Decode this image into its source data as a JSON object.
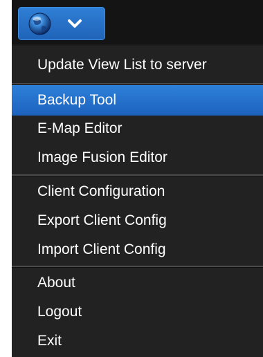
{
  "menu_button": {
    "icon": "globe-icon",
    "dropdown_icon": "chevron-down-icon",
    "accent_color": "#2a73cc"
  },
  "menu": {
    "highlighted_item": "Backup Tool",
    "groups": [
      {
        "items": [
          "Update View List to server"
        ]
      },
      {
        "items": [
          "Backup Tool",
          "E-Map Editor",
          "Image Fusion Editor"
        ]
      },
      {
        "items": [
          "Client Configuration",
          "Export Client Config",
          "Import Client Config"
        ]
      },
      {
        "items": [
          "About",
          "Logout",
          "Exit"
        ]
      }
    ]
  }
}
